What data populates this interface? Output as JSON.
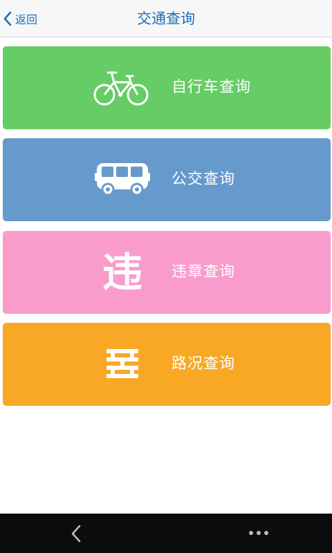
{
  "header": {
    "back_label": "返回",
    "title": "交通查询"
  },
  "tiles": [
    {
      "label": "自行车查询",
      "icon": "bicycle-icon",
      "color": "#66cc66"
    },
    {
      "label": "公交查询",
      "icon": "bus-icon",
      "color": "#6699cc"
    },
    {
      "label": "违章查询",
      "icon": "violation-icon",
      "glyph": "违",
      "color": "#f99ccc"
    },
    {
      "label": "路况查询",
      "icon": "road-condition-icon",
      "color": "#f8a825"
    }
  ],
  "navbar": {
    "back_icon": "chevron-left-icon",
    "more_icon": "more-icon"
  }
}
